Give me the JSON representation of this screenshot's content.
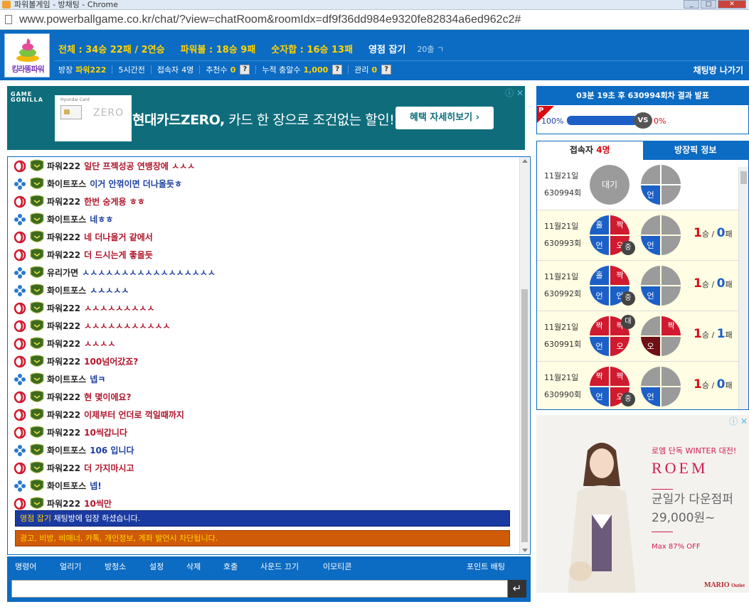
{
  "window": {
    "title": "파워볼게임 - 방채팅 - Chrome",
    "buttons": [
      "_",
      "□",
      "✕"
    ]
  },
  "browser": {
    "url": "www.powerballgame.co.kr/chat/?view=chatRoom&roomIdx=df9f36dd984e9320fe82834a6ed962c2#"
  },
  "header": {
    "logo_text": "킹라똥파워",
    "stats": [
      "전체 : 34승 22패 / 2연승",
      "파워볼 : 18승 9패",
      "숫자합 : 16승 13패"
    ],
    "room_name": "영점 잡기",
    "rank": "20출 ㄱ",
    "info": {
      "owner_label": "방장",
      "owner_value": "파워222",
      "period": "5시간전",
      "visitors_label": "접속자",
      "visitors_value": "4명",
      "recommend_label": "추천수",
      "recommend_value": "0",
      "total_label": "누적 충알수",
      "total_value": "1,000",
      "manage_label": "관리",
      "manage_value": "0",
      "help": "?"
    },
    "leave_label": "채팅방 나가기"
  },
  "ad_top": {
    "logo": "GAME\nGORILLA",
    "card_label": "Hyundai Card",
    "card_zero": "ZERO",
    "headline_bold": "현대카드ZERO,",
    "headline_rest": " 카드 한 장으로 조건없는 할인!",
    "cta": "혜택 자세히보기 ›",
    "flags": "ⓘ ✕"
  },
  "chat": {
    "messages": [
      {
        "user": "파워222",
        "text": "일단 프젝성공 연뱅장에 ㅅㅅㅅ",
        "tone": "red",
        "badge": "red"
      },
      {
        "user": "화이트포스",
        "text": "이거 안꺾이면 더나올듯ㅎ",
        "tone": "blue",
        "badge": "blue"
      },
      {
        "user": "파워222",
        "text": "한번 숭게용 ㅎㅎ",
        "tone": "red",
        "badge": "red"
      },
      {
        "user": "화이트포스",
        "text": "네ㅎㅎ",
        "tone": "blue",
        "badge": "blue"
      },
      {
        "user": "파워222",
        "text": "네 더나올거 같에서",
        "tone": "red",
        "badge": "red"
      },
      {
        "user": "파워222",
        "text": "더 드시는게 좋을듯",
        "tone": "red",
        "badge": "red"
      },
      {
        "user": "유리가면",
        "text": "ㅅㅅㅅㅅㅅㅅㅅㅅㅅㅅㅅㅅㅅㅅㅅㅅㅅ",
        "tone": "blue",
        "badge": "blue"
      },
      {
        "user": "화이트포스",
        "text": "ㅅㅅㅅㅅㅅ",
        "tone": "blue",
        "badge": "blue"
      },
      {
        "user": "파워222",
        "text": "ㅅㅅㅅㅅㅅㅅㅅㅅㅅ",
        "tone": "red",
        "badge": "red"
      },
      {
        "user": "파워222",
        "text": "ㅅㅅㅅㅅㅅㅅㅅㅅㅅㅅㅅ",
        "tone": "red",
        "badge": "red"
      },
      {
        "user": "파워222",
        "text": "ㅅㅅㅅㅅ",
        "tone": "red",
        "badge": "red"
      },
      {
        "user": "파워222",
        "text": "100넘어갔죠?",
        "tone": "red",
        "badge": "red"
      },
      {
        "user": "화이트포스",
        "text": "넵ㅋ",
        "tone": "blue",
        "badge": "blue"
      },
      {
        "user": "파워222",
        "text": "현 몇이에요?",
        "tone": "red",
        "badge": "red"
      },
      {
        "user": "파워222",
        "text": "이제부터 언더로 꺽일때까지",
        "tone": "red",
        "badge": "red"
      },
      {
        "user": "파워222",
        "text": "10씩갑니다",
        "tone": "red",
        "badge": "red"
      },
      {
        "user": "화이트포스",
        "text": "106 입니다",
        "tone": "blue",
        "badge": "blue"
      },
      {
        "user": "파워222",
        "text": "더 가지마시고",
        "tone": "red",
        "badge": "red"
      },
      {
        "user": "화이트포스",
        "text": "넵!",
        "tone": "blue",
        "badge": "blue"
      },
      {
        "user": "파워222",
        "text": "10씩만",
        "tone": "red",
        "badge": "red"
      }
    ],
    "notice_enter_name": "영점 잡기",
    "notice_enter_rest": " 채팅방에 입장 하셨습니다.",
    "notice_warn": "광고, 비방, 비매너, 카톡, 개인정보, 계좌 발언시 차단됩니다."
  },
  "toolbar": {
    "items": [
      "명령어",
      "얼리기",
      "방청소",
      "설정",
      "삭제",
      "호출",
      "사운드 끄기",
      "이모티콘"
    ],
    "point_bet": "포인트 배팅"
  },
  "input": {
    "placeholder": "",
    "send_icon": "↵"
  },
  "result": {
    "time_min": "03분",
    "time_sec": "19초",
    "after_label": "후",
    "round_no": "630994회차",
    "suffix": "결과 발표",
    "p_letter": "P",
    "pct_left": "100%",
    "pct_left_value": 100,
    "vs": "VS",
    "pct_right": "0%"
  },
  "tabs": {
    "active_prefix": "접속자 ",
    "active_count": "4명",
    "inactive": "방장픽 정보"
  },
  "rounds": [
    {
      "date": "11월21일",
      "no": "630994회",
      "wait": "대기",
      "c2": [
        "",
        "",
        "언",
        ""
      ],
      "c2_colors": [
        "#9b9b9b",
        "#9b9b9b",
        "#1c5fc7",
        "#9b9b9b"
      ],
      "score_w": "",
      "score_l": "",
      "yellow": false
    },
    {
      "date": "11월21일",
      "no": "630993회",
      "c1": [
        "홀",
        "짝",
        "언",
        "오"
      ],
      "c1_colors": [
        "#1c5fc7",
        "#d01a2f",
        "#1c5fc7",
        "#d01a2f"
      ],
      "tag": "중",
      "tag_pos": "bottom",
      "c2": [
        "",
        "",
        "언",
        ""
      ],
      "c2_colors": [
        "#9b9b9b",
        "#9b9b9b",
        "#1c5fc7",
        "#9b9b9b"
      ],
      "score_w": "1",
      "score_l": "0",
      "yellow": true
    },
    {
      "date": "11월21일",
      "no": "630992회",
      "c1": [
        "홀",
        "짝",
        "언",
        "언"
      ],
      "c1_colors": [
        "#1c5fc7",
        "#d01a2f",
        "#1c5fc7",
        "#1c5fc7"
      ],
      "tag": "중",
      "tag_pos": "bottom",
      "c2": [
        "",
        "",
        "언",
        ""
      ],
      "c2_colors": [
        "#9b9b9b",
        "#9b9b9b",
        "#1c5fc7",
        "#9b9b9b"
      ],
      "score_w": "1",
      "score_l": "0",
      "yellow": true
    },
    {
      "date": "11월21일",
      "no": "630991회",
      "c1": [
        "짝",
        "짝",
        "언",
        "오"
      ],
      "c1_colors": [
        "#d01a2f",
        "#d01a2f",
        "#1c5fc7",
        "#d01a2f"
      ],
      "tag": "대",
      "tag_pos": "top",
      "c2": [
        "",
        "짝",
        "오",
        ""
      ],
      "c2_colors": [
        "#9b9b9b",
        "#d01a2f",
        "#6e1015",
        "#9b9b9b"
      ],
      "score_w": "1",
      "score_l": "1",
      "yellow": true
    },
    {
      "date": "11월21일",
      "no": "630990회",
      "c1": [
        "짝",
        "짝",
        "언",
        "오"
      ],
      "c1_colors": [
        "#d01a2f",
        "#d01a2f",
        "#1c5fc7",
        "#d01a2f"
      ],
      "tag": "중",
      "tag_pos": "bottom",
      "c2": [
        "",
        "",
        "언",
        ""
      ],
      "c2_colors": [
        "#9b9b9b",
        "#9b9b9b",
        "#1c5fc7",
        "#9b9b9b"
      ],
      "score_w": "1",
      "score_l": "0",
      "yellow": true
    }
  ],
  "score_labels": {
    "win": "승",
    "loss": "패",
    "slash": " / "
  },
  "ad_right": {
    "flags": "ⓘ ✕",
    "promo": "로엠 단독 WINTER 대전!",
    "brand": "ROEM",
    "desc1": "균일가 다운점퍼",
    "desc2": "29,000원~",
    "off": "Max 87% OFF",
    "mario": "MARIO",
    "outlet": "Outlet"
  },
  "colors": {
    "brand_blue": "#0c6bc2",
    "accent_yellow": "#ffd400",
    "red": "#d01a2f",
    "blue": "#1c5fc7"
  }
}
